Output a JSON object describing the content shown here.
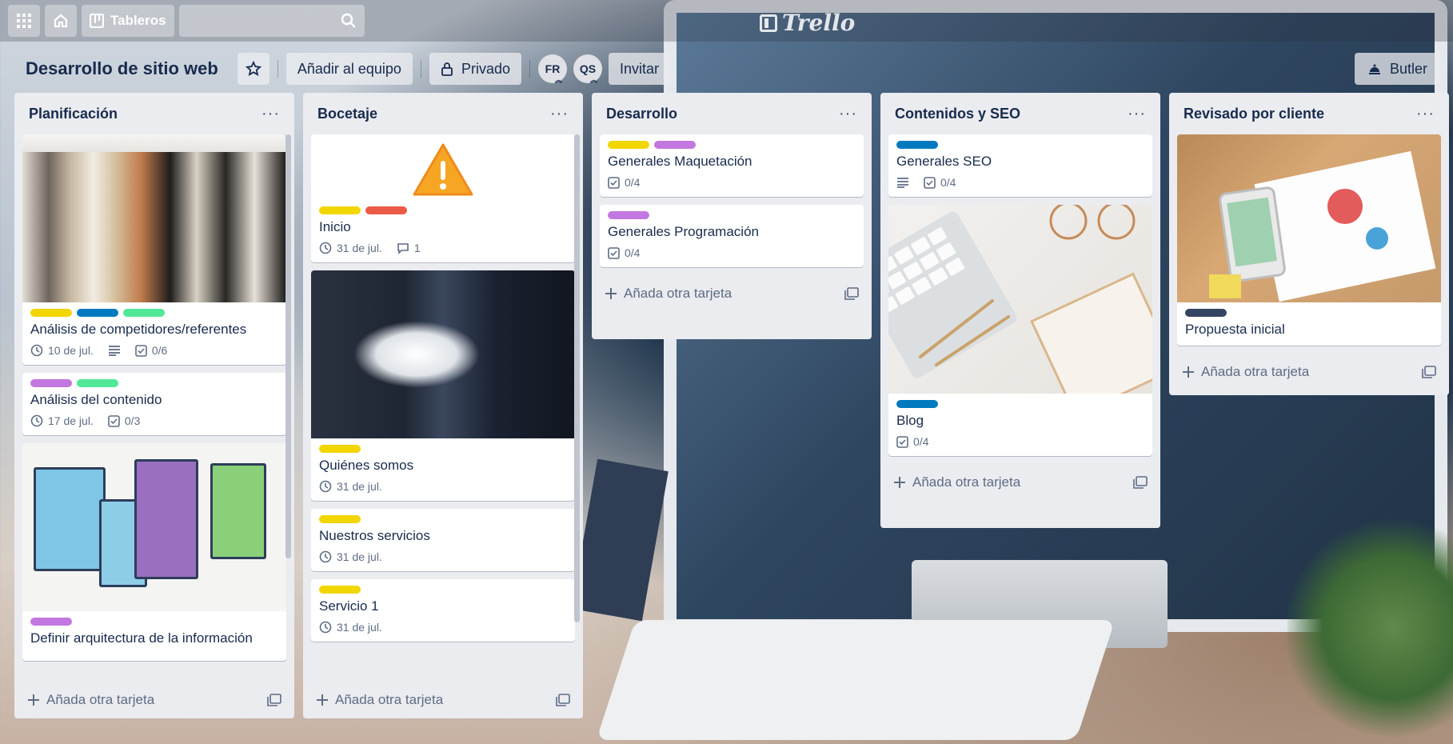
{
  "topbar": {
    "tableros_label": "Tableros",
    "logo_text": "Trello"
  },
  "board": {
    "title": "Desarrollo de sitio web",
    "add_team_label": "Añadir al equipo",
    "privacy_label": "Privado",
    "members": [
      "FR",
      "QS"
    ],
    "invite_label": "Invitar",
    "butler_label": "Butler"
  },
  "add_card_label": "Añada otra tarjeta",
  "colors": {
    "yellow": "#f2d600",
    "blue": "#0079bf",
    "green": "#61bd4f",
    "mint": "#51e898",
    "purple": "#c377e0",
    "red": "#eb5a46",
    "navy": "#344563"
  },
  "lists": [
    {
      "title": "Planificación",
      "cards": [
        {
          "title": "Análisis de competidores/referentes",
          "due": "10 de jul.",
          "checklist": "0/6",
          "labels": [
            "yellow",
            "blue",
            "mint"
          ]
        },
        {
          "title": "Análisis del contenido",
          "due": "17 de jul.",
          "checklist": "0/3",
          "labels": [
            "purple",
            "mint"
          ]
        },
        {
          "title": "Definir arquitectura de la información",
          "labels": [
            "purple"
          ]
        }
      ]
    },
    {
      "title": "Bocetaje",
      "cards": [
        {
          "title": "Inicio",
          "due": "31 de jul.",
          "comments": "1",
          "labels": [
            "yellow",
            "red"
          ]
        },
        {
          "title": "Quiénes somos",
          "due": "31 de jul.",
          "labels": [
            "yellow"
          ]
        },
        {
          "title": "Nuestros servicios",
          "due": "31 de jul.",
          "labels": [
            "yellow"
          ]
        },
        {
          "title": "Servicio 1",
          "due": "31 de jul.",
          "labels": [
            "yellow"
          ]
        }
      ]
    },
    {
      "title": "Desarrollo",
      "cards": [
        {
          "title": "Generales Maquetación",
          "checklist": "0/4",
          "labels": [
            "yellow",
            "purple"
          ]
        },
        {
          "title": "Generales Programación",
          "checklist": "0/4",
          "labels": [
            "purple"
          ]
        }
      ]
    },
    {
      "title": "Contenidos y SEO",
      "cards": [
        {
          "title": "Generales SEO",
          "checklist": "0/4",
          "labels": [
            "blue"
          ]
        },
        {
          "title": "Blog",
          "checklist": "0/4",
          "labels": [
            "blue"
          ]
        }
      ]
    },
    {
      "title": "Revisado por cliente",
      "cards": [
        {
          "title": "Propuesta inicial",
          "labels": [
            "navy"
          ]
        }
      ]
    }
  ]
}
